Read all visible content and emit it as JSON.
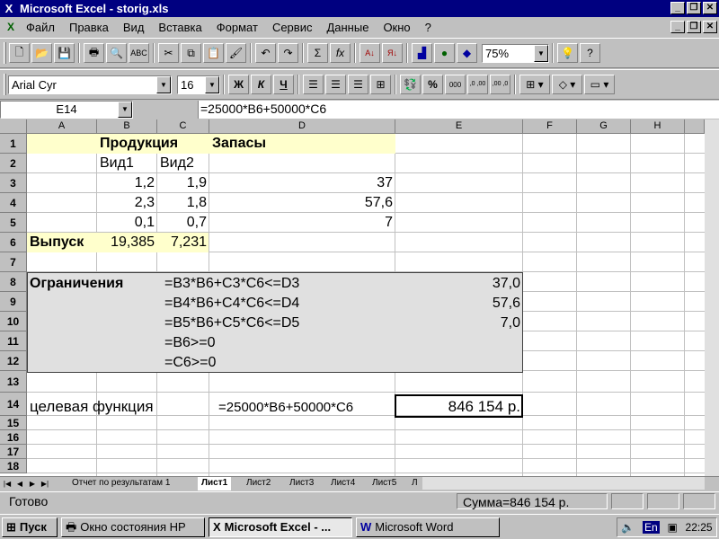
{
  "window": {
    "title": "Microsoft Excel - storig.xls",
    "app_icon": "excel-icon",
    "minimize_label": "_",
    "restore_label": "❐",
    "close_label": "✕"
  },
  "menu": {
    "items": [
      "Файл",
      "Правка",
      "Вид",
      "Вставка",
      "Формат",
      "Сервис",
      "Данные",
      "Окно",
      "?"
    ]
  },
  "toolbar_formatting": {
    "font": "Arial Cyr",
    "size": "16",
    "bold": "Ж",
    "italic": "К",
    "underline": "Ч",
    "percent": "%",
    "thousands": "000",
    "inc_dec": ",0 ,00",
    "dec_dec": ",00 ,0"
  },
  "toolbar_standard": {
    "zoom": "75%",
    "sum": "Σ",
    "fx": "fx"
  },
  "formula_bar": {
    "name_box": "E14",
    "formula": "=25000*B6+50000*C6"
  },
  "columns": [
    "A",
    "B",
    "C",
    "D",
    "E",
    "F",
    "G",
    "H"
  ],
  "rows": [
    "1",
    "2",
    "3",
    "4",
    "5",
    "6",
    "7",
    "8",
    "9",
    "10",
    "11",
    "12",
    "13",
    "14",
    "15",
    "16",
    "17",
    "18"
  ],
  "cells": {
    "B1": "Продукция",
    "D1": "Запасы",
    "B2": "Вид1",
    "C2": "Вид2",
    "B3": "1,2",
    "C3": "1,9",
    "D3": "37",
    "B4": "2,3",
    "C4": "1,8",
    "D4": "57,6",
    "B5": "0,1",
    "C5": "0,7",
    "D5": "7",
    "A6": "Выпуск",
    "B6": "19,385",
    "C6": "7,231",
    "A8": "Ограничения",
    "C8": "=B3*B6+C3*C6<=D3",
    "E8": "37,0",
    "C9": "=B4*B6+C4*C6<=D4",
    "E9": "57,6",
    "C10": "=B5*B6+C5*C6<=D5",
    "E10": "7,0",
    "C11": "=B6>=0",
    "C12": "=C6>=0",
    "A14": "целевая функция",
    "D14": "=25000*B6+50000*C6",
    "E14": "846 154 р."
  },
  "sheet_tabs": [
    "Отчет по результатам 1",
    "Лист1",
    "Лист2",
    "Лист3",
    "Лист4",
    "Лист5",
    "Л"
  ],
  "active_sheet": "Лист1",
  "status": {
    "ready": "Готово",
    "sum": "Сумма=846 154 р."
  },
  "taskbar": {
    "start": "Пуск",
    "buttons": [
      "Окно состояния HP",
      "Microsoft Excel - ...",
      "Microsoft Word"
    ],
    "lang": "En",
    "time": "22:25"
  },
  "colors": {
    "title_bar": "#000080",
    "header_fill": "#ffffcc",
    "block_fill": "#e0e0e0"
  }
}
